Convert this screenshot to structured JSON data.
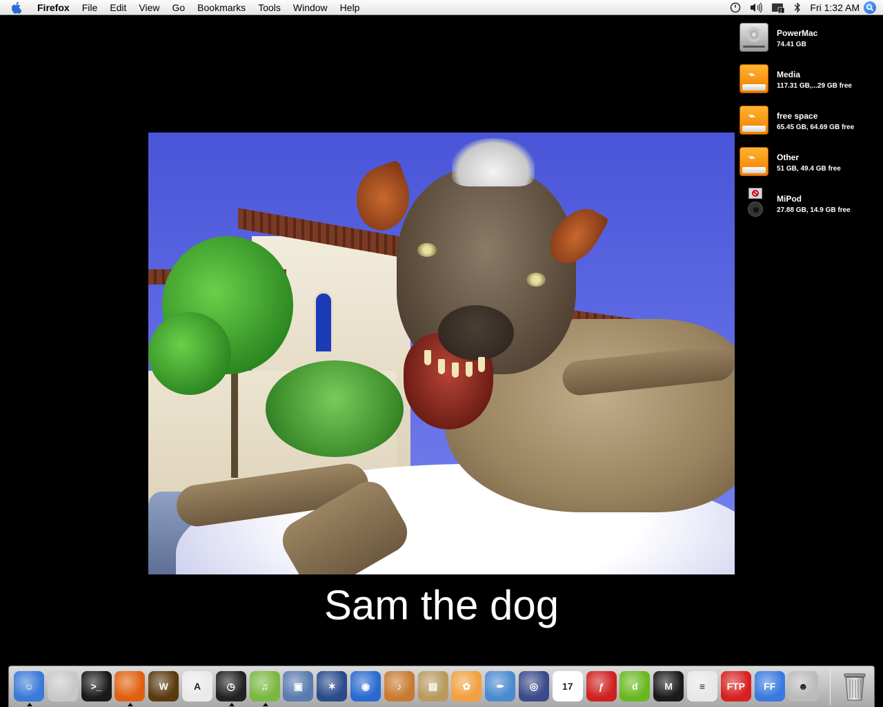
{
  "menubar": {
    "app": "Firefox",
    "items": [
      "File",
      "Edit",
      "View",
      "Go",
      "Bookmarks",
      "Tools",
      "Window",
      "Help"
    ],
    "clock": "Fri 1:32 AM"
  },
  "volumes": [
    {
      "name": "PowerMac",
      "info": "74.41 GB",
      "kind": "hard-drive"
    },
    {
      "name": "Media",
      "info": "117.31 GB,...29 GB free",
      "kind": "firewire-drive"
    },
    {
      "name": "free space",
      "info": "65.45 GB, 64.69 GB free",
      "kind": "firewire-drive"
    },
    {
      "name": "Other",
      "info": "51 GB, 49.4 GB free",
      "kind": "firewire-drive"
    },
    {
      "name": "MiPod",
      "info": "27.88 GB, 14.9 GB free",
      "kind": "ipod"
    }
  ],
  "photo": {
    "subject": "dog-photo"
  },
  "caption": "Sam the dog",
  "dock": {
    "items": [
      {
        "name": "finder-icon",
        "glyph": "☺",
        "bg": "#3a7ad8",
        "running": true
      },
      {
        "name": "system-preferences-icon",
        "glyph": "",
        "bg": "#c8c8c8",
        "running": false
      },
      {
        "name": "terminal-icon",
        "glyph": ">_",
        "bg": "#1a1a1a",
        "running": false
      },
      {
        "name": "firefox-icon",
        "glyph": "",
        "bg": "#e06010",
        "running": true
      },
      {
        "name": "world-of-warcraft-icon",
        "glyph": "W",
        "bg": "#5a3a10",
        "running": false
      },
      {
        "name": "textedit-icon",
        "glyph": "A",
        "bg": "#eaeaea",
        "running": false
      },
      {
        "name": "dashboard-icon",
        "glyph": "◷",
        "bg": "#222",
        "running": true
      },
      {
        "name": "itunes-icon",
        "glyph": "♫",
        "bg": "#7ab840",
        "running": true
      },
      {
        "name": "iphoto-icon",
        "glyph": "▣",
        "bg": "#5a7ab0",
        "running": false
      },
      {
        "name": "imovie-icon",
        "glyph": "✶",
        "bg": "#2a4a8a",
        "running": false
      },
      {
        "name": "idvd-icon",
        "glyph": "◉",
        "bg": "#2a6ad0",
        "running": false
      },
      {
        "name": "garageband-icon",
        "glyph": "♪",
        "bg": "#c87a30",
        "running": false
      },
      {
        "name": "preview-icon",
        "glyph": "▤",
        "bg": "#b89a60",
        "running": false
      },
      {
        "name": "photo-app-icon",
        "glyph": "✿",
        "bg": "#f0a040",
        "running": false
      },
      {
        "name": "mail-icon",
        "glyph": "✒",
        "bg": "#4a8ad0",
        "running": false
      },
      {
        "name": "aperture-icon",
        "glyph": "◎",
        "bg": "#3a4a8a",
        "running": false
      },
      {
        "name": "ical-icon",
        "glyph": "17",
        "bg": "#ffffff",
        "running": false
      },
      {
        "name": "flash-icon",
        "glyph": "ƒ",
        "bg": "#d02020",
        "running": false
      },
      {
        "name": "dreamweaver-icon",
        "glyph": "d",
        "bg": "#6ab820",
        "running": false
      },
      {
        "name": "maya-ple-icon",
        "glyph": "M",
        "bg": "#1a1a1a",
        "running": false
      },
      {
        "name": "textwrangler-icon",
        "glyph": "≡",
        "bg": "#e8e8e8",
        "running": false
      },
      {
        "name": "ftp-icon",
        "glyph": "FTP",
        "bg": "#d82020",
        "running": false
      },
      {
        "name": "fontforge-icon",
        "glyph": "FF",
        "bg": "#3a7ae0",
        "running": false
      },
      {
        "name": "face-app-icon",
        "glyph": "☻",
        "bg": "#bbbbbb",
        "running": false
      }
    ],
    "trash": {
      "name": "trash-icon",
      "glyph": "🗑"
    }
  },
  "colors": {
    "desktop": "#000000",
    "spotlight": "#1560d6",
    "firewire": "#f07c00"
  }
}
